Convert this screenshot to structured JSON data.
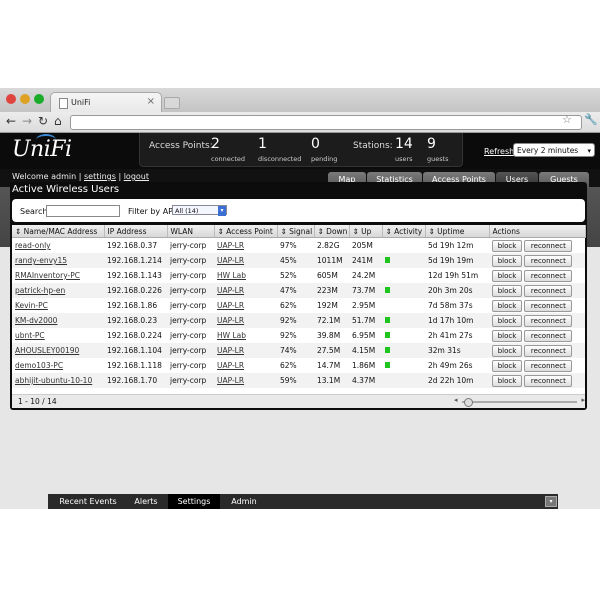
{
  "browser": {
    "tab_title": "UniFi",
    "close_glyph": "×",
    "back_glyph": "←",
    "forward_glyph": "→",
    "reload_glyph": "↻",
    "home_glyph": "⌂",
    "star_glyph": "☆",
    "wrench_glyph": "🔧"
  },
  "header": {
    "logo": "UniFi",
    "access_points_label": "Access Points:",
    "ap_connected": "2",
    "ap_connected_label": "connected",
    "ap_disconnected": "1",
    "ap_disconnected_label": "disconnected",
    "ap_pending": "0",
    "ap_pending_label": "pending",
    "stations_label": "Stations:",
    "users": "14",
    "users_label": "users",
    "guests": "9",
    "guests_label": "guests",
    "refresh_label": "Refresh",
    "refresh_value": "Every 2 minutes"
  },
  "subheader": {
    "welcome": "Welcome admin",
    "sep": "|",
    "settings": "settings",
    "logout": "logout",
    "tabs": [
      "Map",
      "Statistics",
      "Access Points",
      "Users",
      "Guests"
    ],
    "active_tab": "Users"
  },
  "panel": {
    "title": "Active Wireless Users",
    "search_label": "Search",
    "filter_label": "Filter by AP",
    "filter_value": "All (14)",
    "pager_text": "1 - 10 / 14"
  },
  "table": {
    "columns": [
      "Name/MAC Address",
      "IP Address",
      "WLAN",
      "Access Point",
      "Signal",
      "Down",
      "Up",
      "Activity",
      "Uptime",
      "Actions"
    ],
    "block_label": "block",
    "reconnect_label": "reconnect",
    "rows": [
      {
        "name": "read-only",
        "ip": "192.168.0.37",
        "wlan": "jerry-corp",
        "ap": "UAP-LR",
        "signal": "97%",
        "down": "2.82G",
        "up": "205M",
        "active": false,
        "uptime": "5d 19h 12m"
      },
      {
        "name": "randy-envy15",
        "ip": "192.168.1.214",
        "wlan": "jerry-corp",
        "ap": "UAP-LR",
        "signal": "45%",
        "down": "1011M",
        "up": "241M",
        "active": true,
        "uptime": "5d 19h 19m"
      },
      {
        "name": "RMAInventory-PC",
        "ip": "192.168.1.143",
        "wlan": "jerry-corp",
        "ap": "HW Lab",
        "signal": "52%",
        "down": "605M",
        "up": "24.2M",
        "active": false,
        "uptime": "12d 19h 51m"
      },
      {
        "name": "patrick-hp-en",
        "ip": "192.168.0.226",
        "wlan": "jerry-corp",
        "ap": "UAP-LR",
        "signal": "47%",
        "down": "223M",
        "up": "73.7M",
        "active": true,
        "uptime": "20h 3m 20s"
      },
      {
        "name": "Kevin-PC",
        "ip": "192.168.1.86",
        "wlan": "jerry-corp",
        "ap": "UAP-LR",
        "signal": "62%",
        "down": "192M",
        "up": "2.95M",
        "active": false,
        "uptime": "7d 58m 37s"
      },
      {
        "name": "KM-dv2000",
        "ip": "192.168.0.23",
        "wlan": "jerry-corp",
        "ap": "UAP-LR",
        "signal": "92%",
        "down": "72.1M",
        "up": "51.7M",
        "active": true,
        "uptime": "1d 17h 10m"
      },
      {
        "name": "ubnt-PC",
        "ip": "192.168.0.224",
        "wlan": "jerry-corp",
        "ap": "HW Lab",
        "signal": "92%",
        "down": "39.8M",
        "up": "6.95M",
        "active": true,
        "uptime": "2h 41m 27s"
      },
      {
        "name": "AHOUSLEY00190",
        "ip": "192.168.1.104",
        "wlan": "jerry-corp",
        "ap": "UAP-LR",
        "signal": "74%",
        "down": "27.5M",
        "up": "4.15M",
        "active": true,
        "uptime": "32m 31s"
      },
      {
        "name": "demo103-PC",
        "ip": "192.168.1.118",
        "wlan": "jerry-corp",
        "ap": "UAP-LR",
        "signal": "62%",
        "down": "14.7M",
        "up": "1.86M",
        "active": true,
        "uptime": "2h 49m 26s"
      },
      {
        "name": "abhijit-ubuntu-10-10",
        "ip": "192.168.1.70",
        "wlan": "jerry-corp",
        "ap": "UAP-LR",
        "signal": "59%",
        "down": "13.1M",
        "up": "4.37M",
        "active": false,
        "uptime": "2d 22h 10m"
      }
    ]
  },
  "bottom": {
    "tabs": [
      "Recent Events",
      "Alerts",
      "Settings",
      "Admin"
    ],
    "active_tab": "Settings",
    "min_glyph": "▾"
  },
  "colors": {
    "activity": "#1fc41f",
    "logo_accent": "#3a8ad6"
  }
}
